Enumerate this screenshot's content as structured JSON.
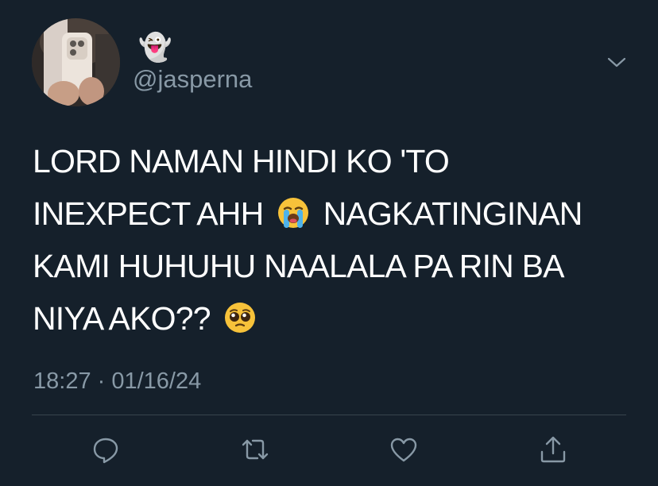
{
  "user": {
    "display_name": "👻",
    "handle": "@jasperna"
  },
  "tweet": {
    "lines": [
      [
        "LORD NAMAN HINDI KO 'TO"
      ],
      [
        "INEXPECT AHH",
        "NAGKATINGINAN"
      ],
      [
        "KAMI HUHUHU NAALALA PA RIN BA"
      ],
      [
        "NIYA AKO??"
      ]
    ],
    "timestamp": "18:27 · 01/16/24"
  },
  "icons": {
    "menu": "chevron-down-icon",
    "reply": "reply-icon",
    "retweet": "retweet-icon",
    "like": "heart-icon",
    "share": "share-icon",
    "emoji_1": "loudly-crying-face-emoji",
    "emoji_2": "pleading-face-emoji"
  },
  "colors": {
    "background": "#15202b",
    "secondary_text": "#8899a6",
    "divider": "#38444d"
  }
}
